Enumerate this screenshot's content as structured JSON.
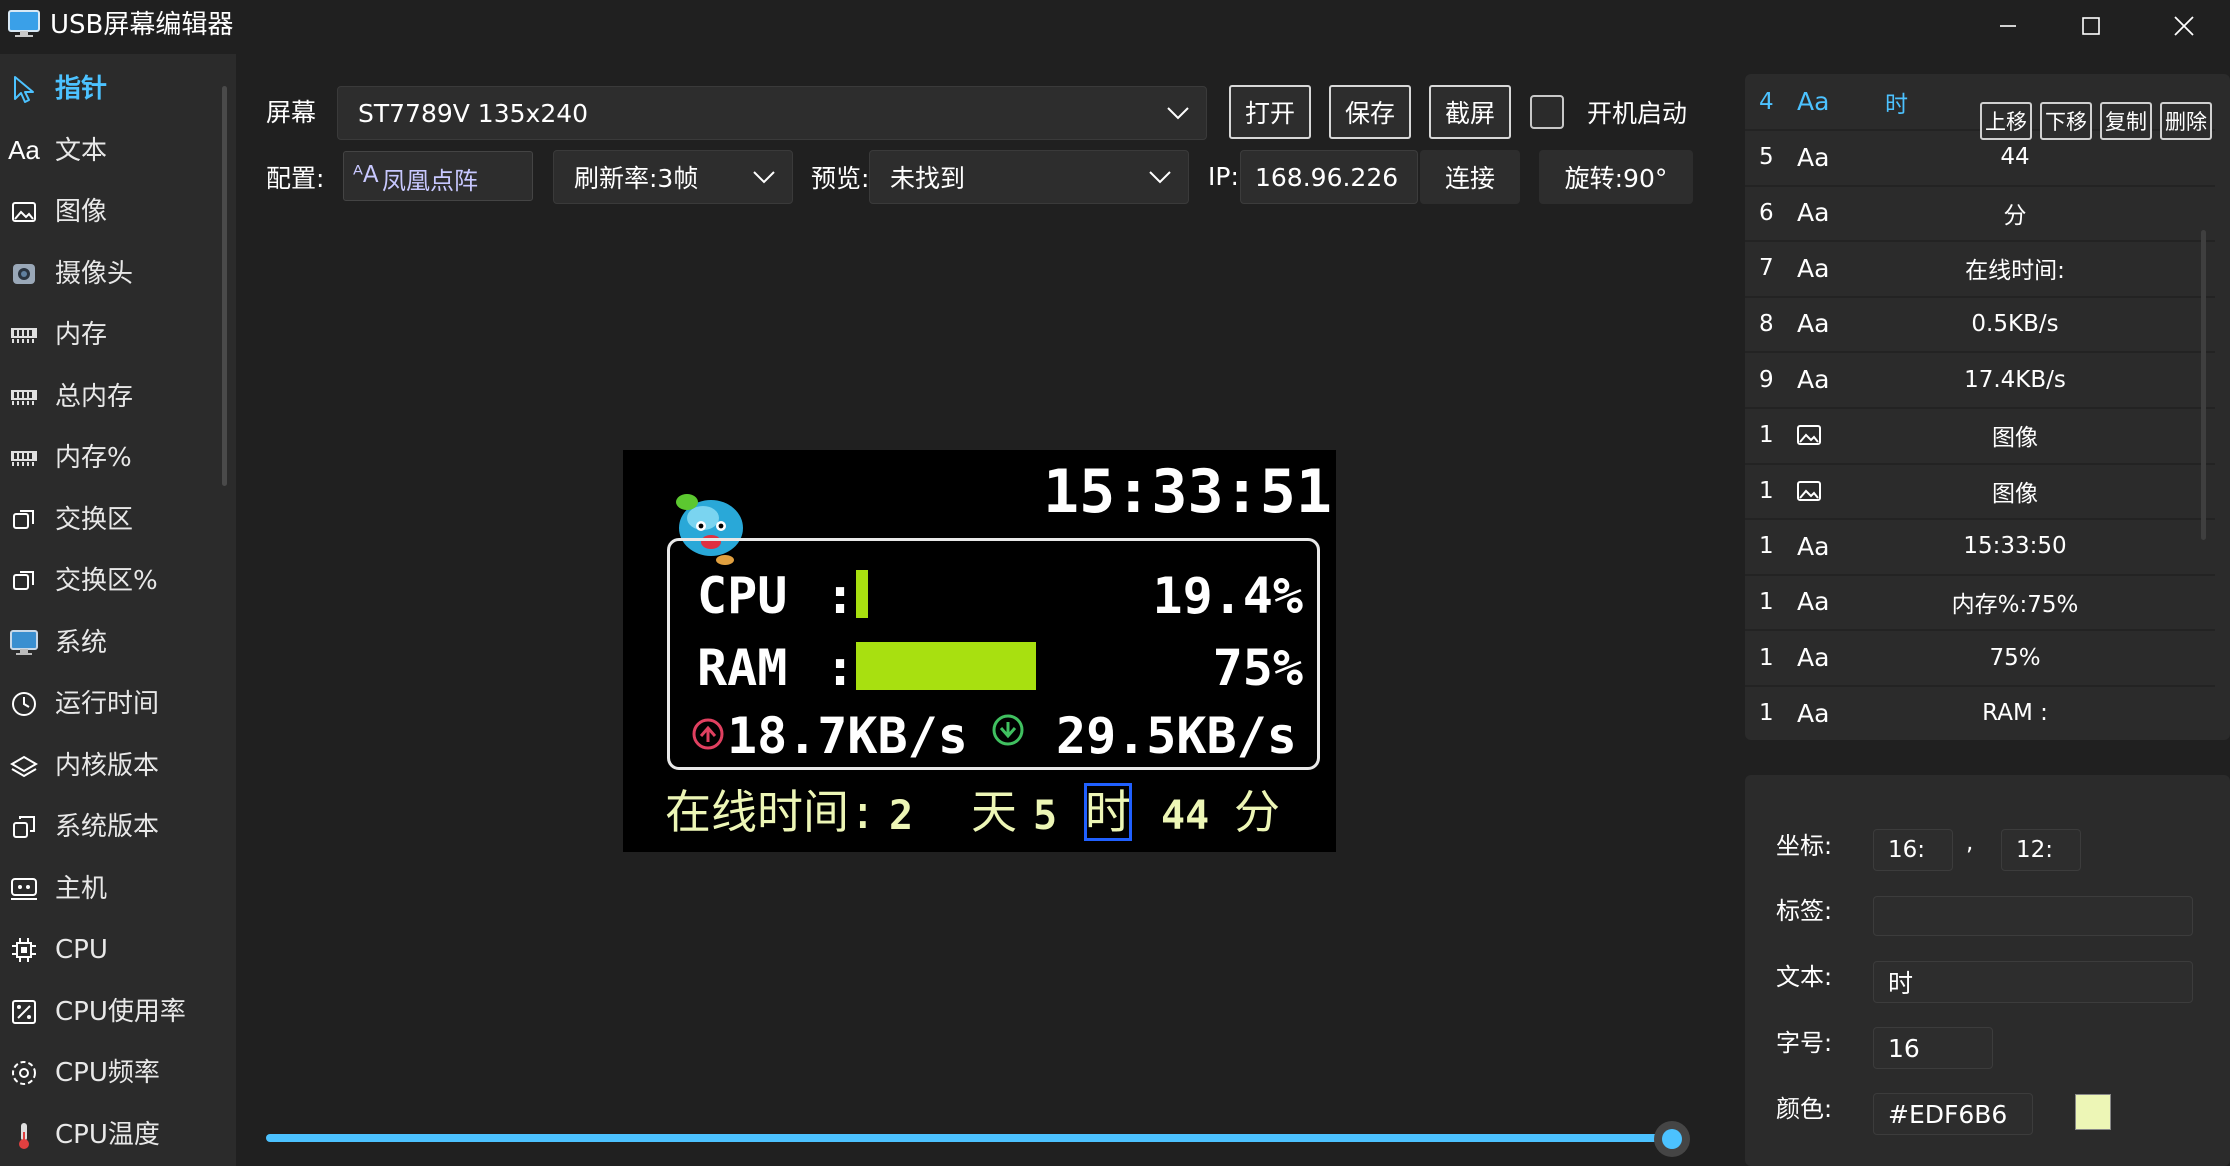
{
  "window": {
    "title": "USB屏幕编辑器",
    "minimize_icon": "minimize-icon",
    "maximize_icon": "maximize-icon",
    "close_icon": "close-icon"
  },
  "toolbox": {
    "items": [
      {
        "label": "指针",
        "icon": "pointer-icon",
        "active": true
      },
      {
        "label": "文本",
        "icon": "text-aa-icon"
      },
      {
        "label": "图像",
        "icon": "image-icon"
      },
      {
        "label": "摄像头",
        "icon": "camera-icon"
      },
      {
        "label": "内存",
        "icon": "memory-icon"
      },
      {
        "label": "总内存",
        "icon": "memory-icon"
      },
      {
        "label": "内存%",
        "icon": "memory-icon"
      },
      {
        "label": "交换区",
        "icon": "swap-icon"
      },
      {
        "label": "交换区%",
        "icon": "swap-icon"
      },
      {
        "label": "系统",
        "icon": "monitor-icon"
      },
      {
        "label": "运行时间",
        "icon": "clock-icon"
      },
      {
        "label": "内核版本",
        "icon": "layers-icon"
      },
      {
        "label": "系统版本",
        "icon": "copy-icon"
      },
      {
        "label": "主机",
        "icon": "host-icon"
      },
      {
        "label": "CPU",
        "icon": "chip-icon"
      },
      {
        "label": "CPU使用率",
        "icon": "percent-icon"
      },
      {
        "label": "CPU频率",
        "icon": "frequency-icon"
      },
      {
        "label": "CPU温度",
        "icon": "thermometer-icon"
      }
    ]
  },
  "top": {
    "screen_label": "屏幕",
    "screen_value": "ST7789V 135x240",
    "open_label": "打开",
    "save_label": "保存",
    "screenshot_label": "截屏",
    "autostart_label": "开机启动",
    "autostart_checked": false,
    "config_label": "配置:",
    "font_value": "凤凰点阵",
    "refresh_value": "刷新率:3帧",
    "preview_label": "预览:",
    "preview_value": "未找到",
    "ip_label": "IP:",
    "ip_value": "168.96.226",
    "connect_label": "连接",
    "rotate_label": "旋转:90°"
  },
  "lcd": {
    "clock": "15:33:51",
    "cpu_label": "CPU",
    "ram_label": "RAM",
    "colon": ":",
    "cpu_percent": "19.4%",
    "cpu_fraction": 0.194,
    "ram_percent": "75%",
    "ram_fraction": 0.75,
    "upload": "18.7KB/s",
    "download": "29.5KB/s",
    "online_label": "在线时间:",
    "days_num": "2",
    "days_unit": "天",
    "hours_num": "5",
    "hours_unit": "时",
    "minutes_num": "44",
    "minutes_unit": "分",
    "bar_color": "#A8E010",
    "text_color": "#EDF6B6",
    "mascot_icon": "mascot-icon"
  },
  "slider": {
    "value": 1.0
  },
  "layers": {
    "move_up": "上移",
    "move_down": "下移",
    "copy": "复制",
    "delete": "删除",
    "rows": [
      {
        "index": "4",
        "type": "Aa",
        "text": "时",
        "selected": true
      },
      {
        "index": "5",
        "type": "Aa",
        "text": "44"
      },
      {
        "index": "6",
        "type": "Aa",
        "text": "分"
      },
      {
        "index": "7",
        "type": "Aa",
        "text": "在线时间:"
      },
      {
        "index": "8",
        "type": "Aa",
        "text": "0.5KB/s"
      },
      {
        "index": "9",
        "type": "Aa",
        "text": "17.4KB/s"
      },
      {
        "index": "1",
        "type": "image",
        "text": "图像"
      },
      {
        "index": "1",
        "type": "image",
        "text": "图像"
      },
      {
        "index": "1",
        "type": "Aa",
        "text": "15:33:50"
      },
      {
        "index": "1",
        "type": "Aa",
        "text": "内存%:75%"
      },
      {
        "index": "1",
        "type": "Aa",
        "text": "75%"
      },
      {
        "index": "1",
        "type": "Aa",
        "text": "RAM :"
      }
    ]
  },
  "props": {
    "coord_label": "坐标:",
    "coord_x": "16:",
    "coord_sep": ",",
    "coord_y": "12:",
    "tag_label": "标签:",
    "tag_value": "",
    "text_label": "文本:",
    "text_value": "时",
    "size_label": "字号:",
    "size_value": "16",
    "color_label": "颜色:",
    "color_value": "#EDF6B6",
    "swatch_color": "#EDF6B6"
  }
}
